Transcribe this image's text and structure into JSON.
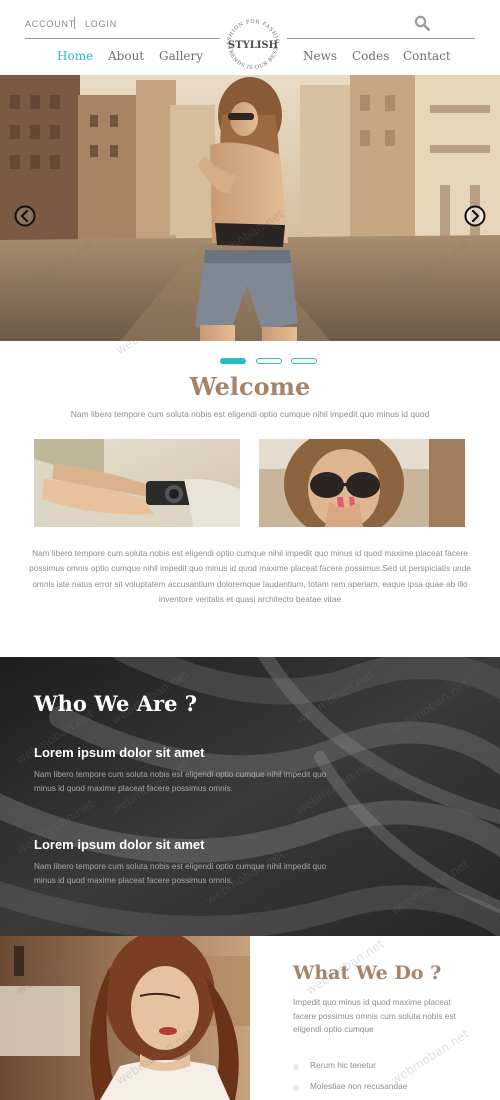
{
  "header": {
    "account": "ACCOUNT",
    "login": "LOGIN",
    "logo_text": "STYLISH",
    "logo_ring_top": "FASHION FOR FASHION",
    "logo_ring_bottom": "TRENDS IS OUR BEST",
    "nav": [
      {
        "label": "Home",
        "active": true
      },
      {
        "label": "About"
      },
      {
        "label": "Gallery"
      },
      {
        "label": "News"
      },
      {
        "label": "Codes"
      },
      {
        "label": "Contact"
      }
    ]
  },
  "hero": {
    "slides_count": 3,
    "active_slide": 1
  },
  "welcome": {
    "title": "Welcome",
    "subtitle": "Nam libero tempore cum soluta nobis est eligendi optio cumque nihil impedit quo minus id quod",
    "body": "Nam libero tempore cum soluta nobis est eligendi optio cumque nihil impedit quo minus id quod maxime placeat facere possimus omnis optio cumque nihil impedit quo minus id quod maxime placeat facere possimus.Sed ut perspiciatis unde omnis iste natus error sit voluptatem accusantium doloremque laudantium, totam rem aperiam, eaque ipsa quae ab illo inventore veritatis et quasi architecto beatae vitae"
  },
  "who": {
    "title": "Who We Are ?",
    "items": [
      {
        "heading": "Lorem ipsum dolor sit amet",
        "text": "Nam libero tempore cum soluta nobis est eligendi optio cumque nihil impedit quo minus id quod maxime placeat facere possimus omnis."
      },
      {
        "heading": "Lorem ipsum dolor sit amet",
        "text": "Nam libero tempore cum soluta nobis est eligendi optio cumque nihil impedit quo minus id quod maxime placeat facere possimus omnis."
      }
    ]
  },
  "what_we_do": {
    "title": "What We Do ?",
    "text": "Impedit quo minus id quod maxime placeat facere possimus omnis cum soluta nobis est eligendi optio cumque",
    "items": [
      "Rerum hic tenetur",
      "Molestiae non recusandae"
    ]
  },
  "watermark": "webmoban.net",
  "colors": {
    "accent": "#2bbac9",
    "heading_brown": "#a4856a"
  }
}
